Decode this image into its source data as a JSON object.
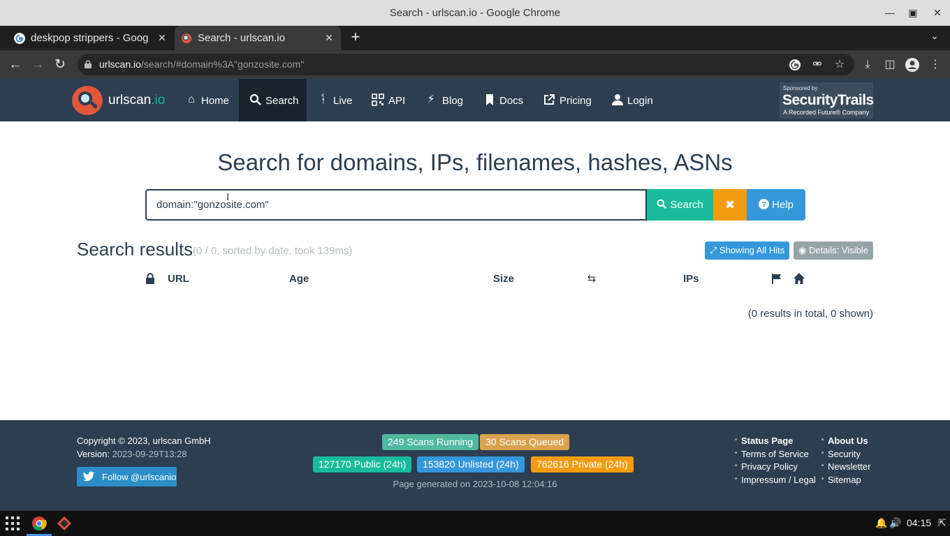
{
  "window": {
    "title": "Search - urlscan.io - Google Chrome"
  },
  "tabs": [
    {
      "label": "deskpop strippers - Goog",
      "favicon": "google-icon"
    },
    {
      "label": "Search - urlscan.io",
      "favicon": "urlscan-icon",
      "active": true
    }
  ],
  "address": {
    "host": "urlscan.io",
    "path": "/search/#domain%3A\"gonzosite.com\""
  },
  "nav": {
    "brand_main": "urlscan",
    "brand_io": ".io",
    "items": [
      {
        "label": "Home",
        "icon": "home-icon"
      },
      {
        "label": "Search",
        "icon": "search-icon",
        "active": true
      },
      {
        "label": "Live",
        "icon": "fire-icon"
      },
      {
        "label": "API",
        "icon": "qrcode-icon"
      },
      {
        "label": "Blog",
        "icon": "bolt-icon"
      },
      {
        "label": "Docs",
        "icon": "bookmark-icon"
      },
      {
        "label": "Pricing",
        "icon": "external-link-icon"
      },
      {
        "label": "Login",
        "icon": "user-icon"
      }
    ],
    "sponsor_small": "Sponsored by",
    "sponsor_name": "SecurityTrails",
    "sponsor_tag": "A Recorded Future® Company"
  },
  "hero": {
    "heading": "Search for domains, IPs, filenames, hashes, ASNs"
  },
  "search": {
    "value": "domain:\"gonzosite.com\"",
    "search_label": "Search",
    "clear_label": "✖",
    "help_label": "Help"
  },
  "results": {
    "title": "Search results",
    "meta": "(0 / 0, sorted by date, took 139ms)",
    "hits_label": "Showing All Hits",
    "details_label": "Details: Visible",
    "columns": {
      "url": "URL",
      "age": "Age",
      "size": "Size",
      "ips": "IPs"
    },
    "summary": "(0 results in total, 0 shown)"
  },
  "footer": {
    "copyright": "Copyright © 2023, urlscan GmbH",
    "version_label": "Version:",
    "version_value": "2023-09-29T13:28",
    "twitter_label": "Follow @urlscanio",
    "stats": {
      "running": "249 Scans Running",
      "queued": "30 Scans Queued",
      "public": "127170 Public (24h)",
      "unlisted": "153820 Unlisted (24h)",
      "private": "762616 Private (24h)"
    },
    "generated": "Page generated on 2023-10-08 12:04:16",
    "links_col1": [
      "Status Page",
      "Terms of Service",
      "Privacy Policy",
      "Impressum / Legal"
    ],
    "links_col2": [
      "About Us",
      "Security",
      "Newsletter",
      "Sitemap"
    ]
  },
  "taskbar": {
    "time": "04:15"
  },
  "colors": {
    "navbar": "#2c3e50",
    "success": "#18bc9c",
    "warning": "#f39c12",
    "info": "#3498db",
    "muted": "#95a5a6"
  }
}
